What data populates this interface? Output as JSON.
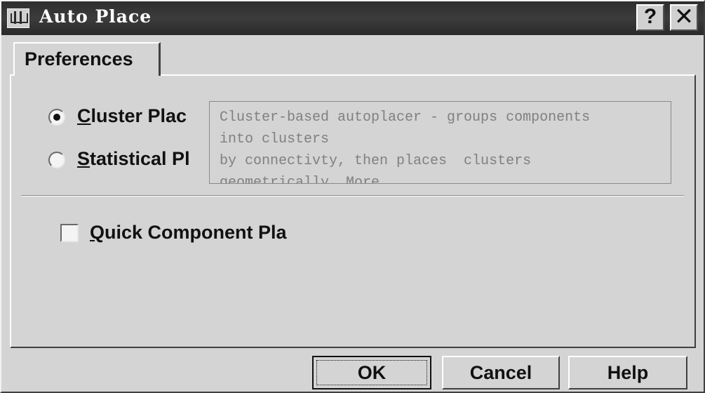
{
  "window": {
    "title": "Auto Place",
    "help_glyph": "?",
    "close_glyph": "✕",
    "icon": "app-icon"
  },
  "tabs": [
    {
      "label": "Preferences",
      "selected": true
    }
  ],
  "options": {
    "cluster": {
      "label": "Cluster Plac",
      "selected": true
    },
    "statistical": {
      "label": "Statistical Pl",
      "selected": false
    }
  },
  "description": "Cluster-based autoplacer - groups components\ninto clusters\nby connectivty, then places  clusters\ngeometrically. More",
  "quick_component": {
    "label": "Quick Component Pla",
    "checked": false
  },
  "buttons": {
    "ok": "OK",
    "cancel": "Cancel",
    "help": "Help"
  }
}
